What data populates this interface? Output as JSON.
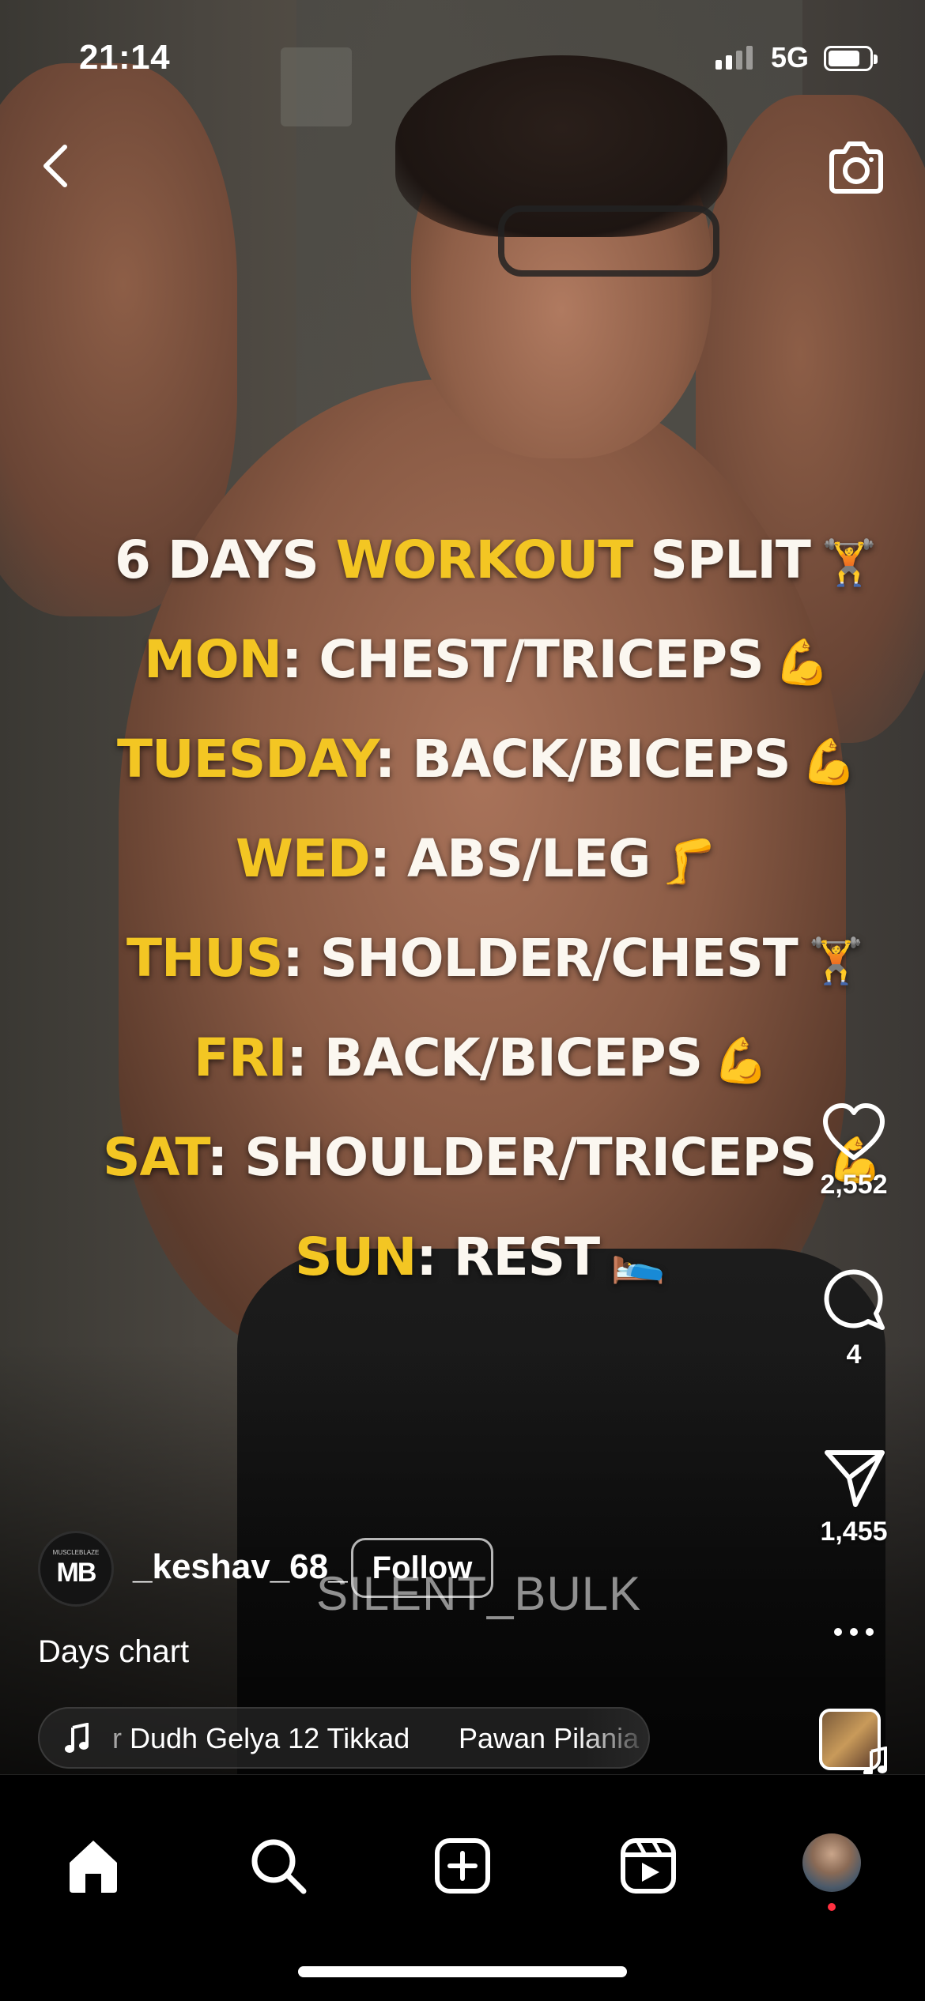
{
  "status_bar": {
    "time": "21:14",
    "network": "5G"
  },
  "overlay": {
    "lines": [
      {
        "parts": [
          {
            "text": "6 DAYS ",
            "color": "white"
          },
          {
            "text": "WORKOUT",
            "color": "yellow"
          },
          {
            "text": " SPLIT",
            "color": "white"
          }
        ],
        "emoji": "🏋️"
      },
      {
        "parts": [
          {
            "text": "MON",
            "color": "yellow"
          },
          {
            "text": ": CHEST/TRICEPS",
            "color": "white"
          }
        ],
        "emoji": "💪"
      },
      {
        "parts": [
          {
            "text": "TUESDAY",
            "color": "yellow"
          },
          {
            "text": ": BACK/BICEPS",
            "color": "white"
          }
        ],
        "emoji": "💪"
      },
      {
        "parts": [
          {
            "text": "WED",
            "color": "yellow"
          },
          {
            "text": ": ABS/LEG",
            "color": "white"
          }
        ],
        "emoji": "🦵"
      },
      {
        "parts": [
          {
            "text": "THUS",
            "color": "yellow"
          },
          {
            "text": ": SHOLDER/CHEST",
            "color": "white"
          }
        ],
        "emoji": "🏋️"
      },
      {
        "parts": [
          {
            "text": "FRI",
            "color": "yellow"
          },
          {
            "text": ": BACK/BICEPS",
            "color": "white"
          }
        ],
        "emoji": "💪"
      },
      {
        "parts": [
          {
            "text": "SAT",
            "color": "yellow"
          },
          {
            "text": ": SHOULDER/TRICEPS",
            "color": "white"
          }
        ],
        "emoji": "💪"
      },
      {
        "parts": [
          {
            "text": "SUN",
            "color": "yellow"
          },
          {
            "text": ": REST",
            "color": "white"
          }
        ],
        "emoji": "🛌"
      }
    ],
    "watermark": "SILENT_BULK"
  },
  "actions": {
    "likes": "2,552",
    "comments": "4",
    "shares": "1,455"
  },
  "post": {
    "avatar_text": "MB",
    "avatar_small": "MUSCLEBLAZE",
    "username": "_keshav_68_",
    "follow_label": "Follow",
    "caption": "Days chart"
  },
  "music": {
    "track": "Dudh Gelya 12 Tikkad",
    "track_prefix": "r",
    "artist": "Pawan Pilania"
  },
  "colors": {
    "yellow": "#f3c623",
    "white": "#fbf7f0",
    "notification": "#ff3040"
  },
  "icons": [
    "back-icon",
    "camera-icon",
    "heart-icon",
    "comment-icon",
    "share-icon",
    "more-icon",
    "music-note-icon",
    "home-icon",
    "search-icon",
    "create-icon",
    "reels-icon"
  ]
}
